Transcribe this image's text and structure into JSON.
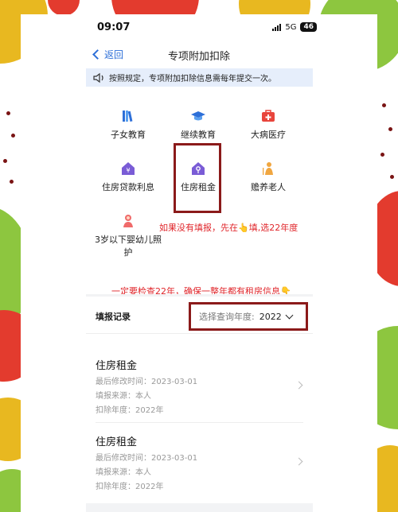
{
  "status_bar": {
    "time": "09:07",
    "network": "5G",
    "battery": "46"
  },
  "nav": {
    "back_label": "返回",
    "title": "专项附加扣除"
  },
  "notice": {
    "text": "按照规定，专项附加扣除信息需每年提交一次。"
  },
  "categories": [
    {
      "label": "子女教育",
      "icon": "books-icon"
    },
    {
      "label": "继续教育",
      "icon": "graduation-cap-icon"
    },
    {
      "label": "大病医疗",
      "icon": "medical-kit-icon"
    },
    {
      "label": "住房贷款利息",
      "icon": "house-yuan-icon"
    },
    {
      "label": "住房租金",
      "icon": "house-key-icon"
    },
    {
      "label": "赡养老人",
      "icon": "elderly-icon"
    },
    {
      "label": "3岁以下婴幼儿照护",
      "icon": "baby-icon"
    }
  ],
  "annotations": {
    "fill_hint": "如果没有填报，先在👆填,选22年度",
    "check_hint": "一定要检查22年，确保一整年都有租房信息👇"
  },
  "records": {
    "title": "填报记录",
    "year_filter_label": "选择查询年度:",
    "year_value": "2022",
    "items": [
      {
        "name": "住房租金",
        "modified": "最后修改时间：2023-03-01",
        "source": "填报来源：本人",
        "year": "扣除年度：2022年"
      },
      {
        "name": "住房租金",
        "modified": "最后修改时间：2023-03-01",
        "source": "填报来源：本人",
        "year": "扣除年度：2022年"
      }
    ]
  },
  "colors": {
    "accent": "#2d6fd8",
    "annotation": "#e0262b",
    "highlight_border": "#8b1a1a",
    "notice_bg": "#e6eefb"
  }
}
